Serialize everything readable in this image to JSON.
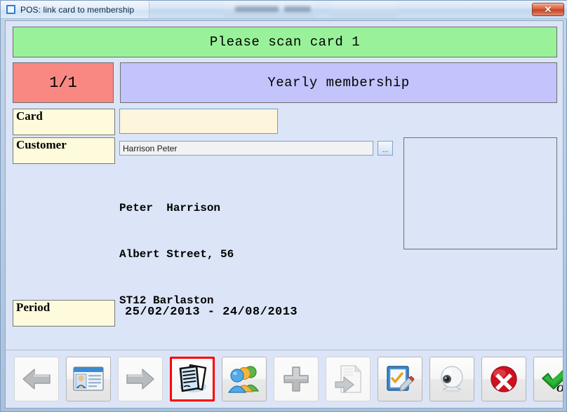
{
  "window": {
    "title": "POS: link card to membership",
    "app_icon": "window-square-icon",
    "close_label": "✕"
  },
  "banner": {
    "status_text": "Please scan card 1",
    "status_bg": "#99f299",
    "counter_text": "1/1",
    "counter_bg": "#f98883",
    "membership_text": "Yearly membership",
    "membership_bg": "#c3c4fb"
  },
  "fields": {
    "card_label": "Card",
    "card_value": "",
    "card_placeholder": "",
    "customer_label": "Customer",
    "customer_value": "Harrison Peter",
    "customer_browse_label": "...",
    "period_label": "Period",
    "period_value": "25/02/2013 - 24/08/2013"
  },
  "address": {
    "line1": "Peter  Harrison",
    "line2": "Albert Street, 56",
    "line3": "ST12 Barlaston"
  },
  "toolbar": {
    "buttons": [
      {
        "name": "previous-button",
        "icon": "left-arrow-icon",
        "state": "flat"
      },
      {
        "name": "customer-card-button",
        "icon": "id-card-icon",
        "state": "normal"
      },
      {
        "name": "next-button",
        "icon": "right-arrow-icon",
        "state": "flat"
      },
      {
        "name": "documents-button",
        "icon": "documents-icon",
        "state": "selected"
      },
      {
        "name": "members-button",
        "icon": "people-group-icon",
        "state": "normal"
      },
      {
        "name": "add-button",
        "icon": "plus-icon",
        "state": "flat"
      },
      {
        "name": "export-button",
        "icon": "export-file-icon",
        "state": "flat"
      },
      {
        "name": "edit-form-button",
        "icon": "checklist-pen-icon",
        "state": "normal"
      },
      {
        "name": "webcam-button",
        "icon": "webcam-icon",
        "state": "normal"
      },
      {
        "name": "cancel-button",
        "icon": "red-x-circle-icon",
        "state": "normal"
      },
      {
        "name": "ok-button",
        "icon": "green-check-ok-icon",
        "state": "normal"
      }
    ],
    "ok_text": "OK"
  }
}
